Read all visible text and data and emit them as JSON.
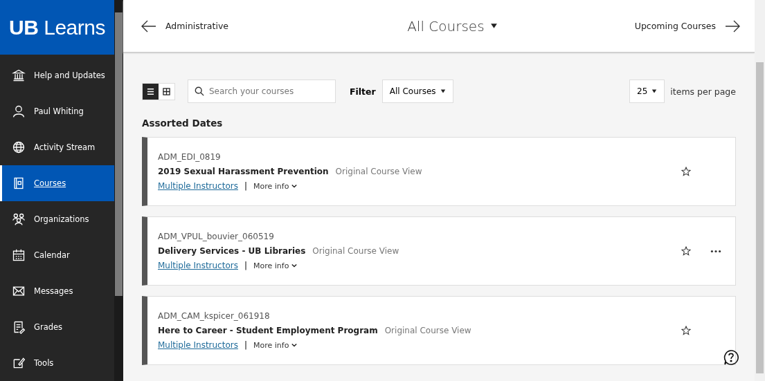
{
  "logo": {
    "bold": "UB",
    "light": "Learns"
  },
  "sidebar": {
    "items": [
      {
        "label": "Help and Updates",
        "kind": "bank",
        "selected": false
      },
      {
        "label": "Paul Whiting",
        "kind": "person",
        "selected": false
      },
      {
        "label": "Activity Stream",
        "kind": "globe",
        "selected": false
      },
      {
        "label": "Courses",
        "kind": "book",
        "selected": true
      },
      {
        "label": "Organizations",
        "kind": "people",
        "selected": false
      },
      {
        "label": "Calendar",
        "kind": "calendar",
        "selected": false
      },
      {
        "label": "Messages",
        "kind": "mail",
        "selected": false
      },
      {
        "label": "Grades",
        "kind": "grades",
        "selected": false
      },
      {
        "label": "Tools",
        "kind": "tools",
        "selected": false
      }
    ]
  },
  "header": {
    "back": "Administrative",
    "title": "All Courses",
    "next": "Upcoming Courses"
  },
  "toolbar": {
    "views": [
      {
        "kind": "list",
        "selected": true
      },
      {
        "kind": "grid",
        "selected": false
      }
    ],
    "search": {
      "placeholder": "Search your courses"
    },
    "filter_label": "Filter",
    "filter_value": "All Courses",
    "per_page": "25",
    "per_page_label": "items per page"
  },
  "section_title": "Assorted Dates",
  "courses": [
    {
      "code": "ADM_EDI_0819",
      "title": "2019 Sexual Harassment Prevention",
      "view": "Original Course View",
      "instructors": "Multiple Instructors",
      "separator": "|",
      "more": "More info",
      "menu": false
    },
    {
      "code": "ADM_VPUL_bouvier_060519",
      "title": "Delivery Services - UB Libraries",
      "view": "Original Course View",
      "instructors": "Multiple Instructors",
      "separator": "|",
      "more": "More info",
      "menu": true
    },
    {
      "code": "ADM_CAM_kspicer_061918",
      "title": "Here to Career - Student Employment Program",
      "view": "Original Course View",
      "instructors": "Multiple Instructors",
      "separator": "|",
      "more": "More info",
      "menu": false
    }
  ]
}
